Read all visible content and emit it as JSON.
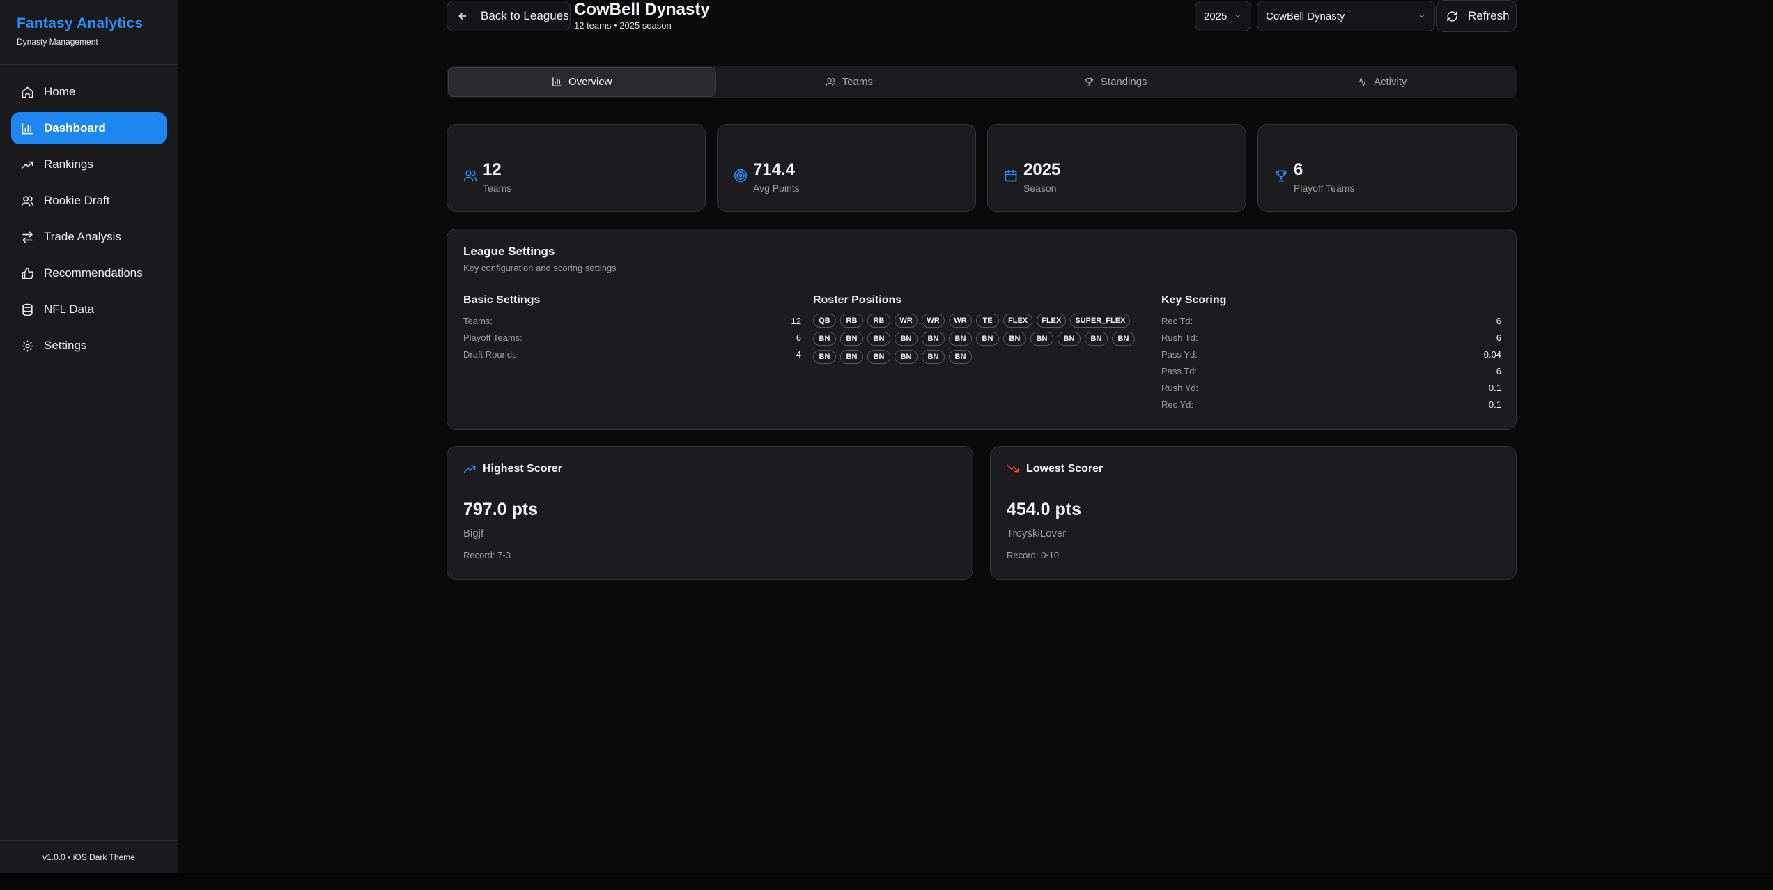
{
  "sidebar": {
    "brand_title": "Fantasy Analytics",
    "brand_subtitle": "Dynasty Management",
    "items": [
      {
        "label": "Home",
        "icon": "home-icon"
      },
      {
        "label": "Dashboard",
        "icon": "bar-chart-icon",
        "active": true
      },
      {
        "label": "Rankings",
        "icon": "trending-up-icon"
      },
      {
        "label": "Rookie Draft",
        "icon": "users-icon"
      },
      {
        "label": "Trade Analysis",
        "icon": "swap-arrows-icon"
      },
      {
        "label": "Recommendations",
        "icon": "thumbs-up-icon"
      },
      {
        "label": "NFL Data",
        "icon": "database-icon"
      },
      {
        "label": "Settings",
        "icon": "gear-icon"
      }
    ],
    "footer": "v1.0.0 • iOS Dark Theme"
  },
  "header": {
    "back_label": "Back to Leagues",
    "league_name": "CowBell Dynasty",
    "league_sub": "12 teams • 2025 season",
    "year_value": "2025",
    "league_select_value": "CowBell Dynasty",
    "refresh_label": "Refresh"
  },
  "tabs": [
    {
      "label": "Overview",
      "icon": "bar-chart-icon",
      "active": true
    },
    {
      "label": "Teams",
      "icon": "users-icon"
    },
    {
      "label": "Standings",
      "icon": "trophy-icon"
    },
    {
      "label": "Activity",
      "icon": "activity-icon"
    }
  ],
  "stats": [
    {
      "value": "12",
      "label": "Teams",
      "icon": "users-icon"
    },
    {
      "value": "714.4",
      "label": "Avg Points",
      "icon": "target-icon"
    },
    {
      "value": "2025",
      "label": "Season",
      "icon": "calendar-icon"
    },
    {
      "value": "6",
      "label": "Playoff Teams",
      "icon": "trophy-icon"
    }
  ],
  "settings": {
    "title": "League Settings",
    "description": "Key configuration and scoring settings",
    "basic_title": "Basic Settings",
    "basic": [
      {
        "k": "Teams:",
        "v": "12"
      },
      {
        "k": "Playoff Teams:",
        "v": "6"
      },
      {
        "k": "Draft Rounds:",
        "v": "4"
      }
    ],
    "roster_title": "Roster Positions",
    "roster": [
      "QB",
      "RB",
      "RB",
      "WR",
      "WR",
      "WR",
      "TE",
      "FLEX",
      "FLEX",
      "SUPER_FLEX",
      "BN",
      "BN",
      "BN",
      "BN",
      "BN",
      "BN",
      "BN",
      "BN",
      "BN",
      "BN",
      "BN",
      "BN",
      "BN",
      "BN",
      "BN",
      "BN",
      "BN",
      "BN"
    ],
    "scoring_title": "Key Scoring",
    "scoring": [
      {
        "k": "Rec Td:",
        "v": "6"
      },
      {
        "k": "Rush Td:",
        "v": "6"
      },
      {
        "k": "Pass Yd:",
        "v": "0.04"
      },
      {
        "k": "Pass Td:",
        "v": "6"
      },
      {
        "k": "Rush Yd:",
        "v": "0.1"
      },
      {
        "k": "Rec Yd:",
        "v": "0.1"
      }
    ]
  },
  "highest": {
    "title": "Highest Scorer",
    "points": "797.0 pts",
    "name": "Bigjf",
    "record": "Record: 7-3",
    "color": "#2a8cf5"
  },
  "lowest": {
    "title": "Lowest Scorer",
    "points": "454.0 pts",
    "name": "TroyskiLover",
    "record": "Record: 0-10",
    "color": "#ff453a"
  }
}
